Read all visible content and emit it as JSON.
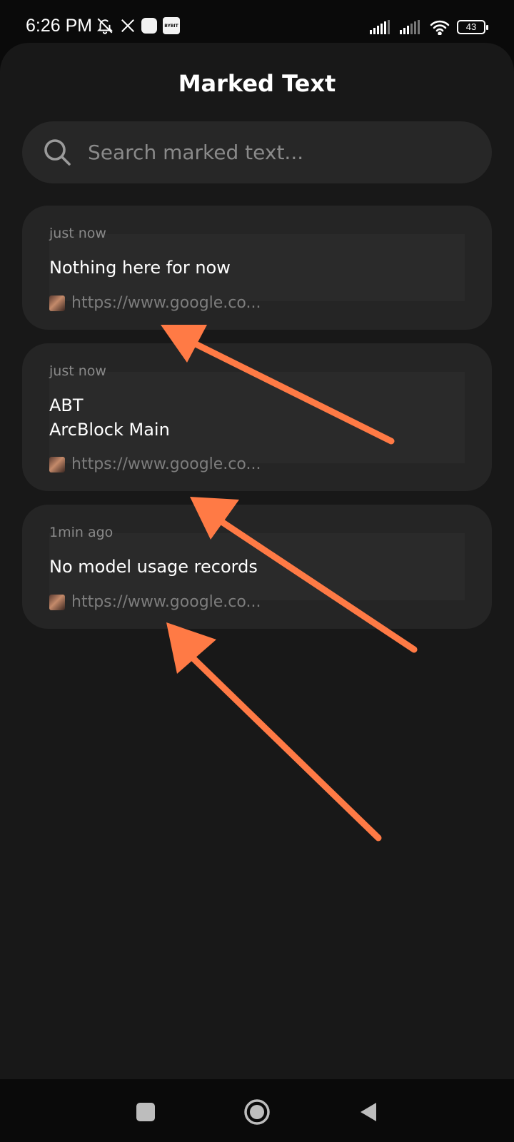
{
  "status_bar": {
    "time": "6:26 PM",
    "left_icons": [
      "bell-off-icon",
      "x-logo-icon",
      "app-icon",
      "bybit-icon"
    ],
    "bybit_label": "BYBIT",
    "battery_level": "43",
    "right_icons": [
      "signal-icon",
      "signal-icon",
      "wifi-icon",
      "battery-icon"
    ]
  },
  "header": {
    "title": "Marked Text"
  },
  "search": {
    "placeholder": "Search marked text...",
    "value": "",
    "icon": "search-icon"
  },
  "cards": [
    {
      "time": "just now",
      "text": "Nothing here for now",
      "link": "https://www.google.co..."
    },
    {
      "time": "just now",
      "text": "ABT\nArcBlock Main",
      "link": "https://www.google.co..."
    },
    {
      "time": "1min ago",
      "text": "No model usage records",
      "link": "https://www.google.co..."
    }
  ],
  "annotation": {
    "arrow_color": "#ff7a45",
    "arrow_count": 3
  },
  "nav_bar": {
    "buttons": [
      "recents-button",
      "home-button",
      "back-button"
    ]
  },
  "colors": {
    "background": "#181818",
    "card": "#252525",
    "search": "#272727",
    "text_primary": "#ffffff",
    "text_secondary": "#8a8a8a"
  }
}
